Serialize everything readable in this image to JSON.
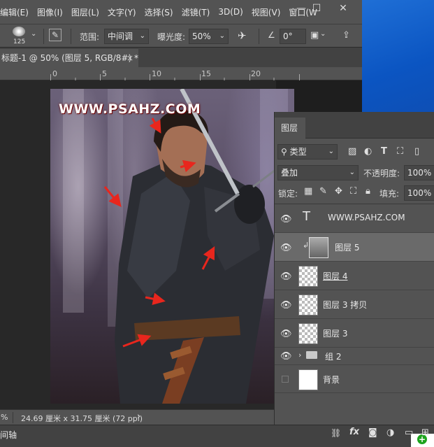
{
  "menubar": {
    "items": [
      "编辑(E)",
      "图像(I)",
      "图层(L)",
      "文字(Y)",
      "选择(S)",
      "滤镜(T)",
      "3D(D)",
      "视图(V)",
      "窗口(W"
    ],
    "first_item_visible": "辑(",
    "window_controls": {
      "minimize": "—",
      "maximize": "☐",
      "close": "✕"
    }
  },
  "options": {
    "brush_size": "125",
    "range_label": "范围:",
    "range_value": "中间调",
    "exposure_label": "曝光度:",
    "exposure_value": "50%",
    "angle_value": "0°"
  },
  "document_tab": {
    "title": "标题-1 @ 50% (图层 5, RGB/8#) *",
    "close": "×"
  },
  "ruler": {
    "ticks": [
      "0",
      "5",
      "10",
      "15",
      "20"
    ]
  },
  "canvas": {
    "watermark": "WWW.PSAHZ.COM"
  },
  "status": {
    "zoom": "%",
    "doc_info": "24.69 厘米 x 31.75 厘米 (72 ppi)",
    "arrow": "›"
  },
  "timeline": {
    "label": "间轴"
  },
  "layers_panel": {
    "tab": "图层",
    "filter_label": "类型",
    "blend_mode": "叠加",
    "opacity_label": "不透明度:",
    "opacity_value": "100%",
    "lock_label": "锁定:",
    "fill_label": "填充:",
    "fill_value": "100%",
    "layers": [
      {
        "name": "WWW.PSAHZ.COM",
        "kind": "text",
        "visible": true
      },
      {
        "name": "图层 5",
        "kind": "clipped",
        "visible": true,
        "selected": true
      },
      {
        "name": "图层 4",
        "kind": "pixel",
        "visible": true
      },
      {
        "name": "图层 3 拷贝",
        "kind": "pixel",
        "visible": true
      },
      {
        "name": "图层 3",
        "kind": "pixel",
        "visible": true
      },
      {
        "name": "组 2",
        "kind": "group",
        "visible": true
      },
      {
        "name": "背景",
        "kind": "background",
        "visible": false
      }
    ],
    "footer_icons": [
      "link-icon",
      "fx-icon",
      "mask-icon",
      "adjustment-icon",
      "folder-icon",
      "new-layer-icon"
    ]
  },
  "colors": {
    "ui_bg": "#535353",
    "panel_dark": "#424242",
    "selected_row": "#6a6a6a",
    "arrow_red": "#e8261d",
    "desktop_blue": "#0b55c2"
  }
}
